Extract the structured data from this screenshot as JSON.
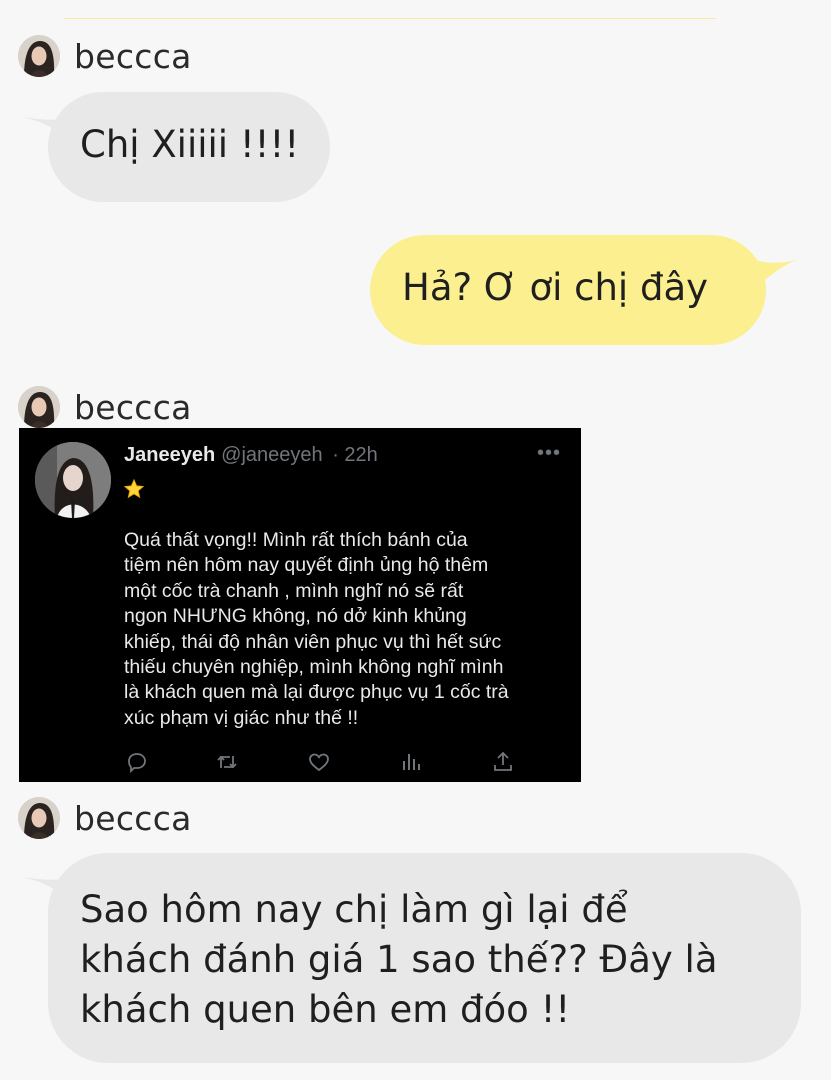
{
  "chat": {
    "messages": [
      {
        "sender": "beccca",
        "text": "Chị Xiiiii !!!!"
      },
      {
        "sender": "me",
        "text": "Hả? Ơ ơi chị đây"
      },
      {
        "sender": "beccca",
        "tweet": true
      },
      {
        "sender": "beccca",
        "lines": [
          "Sao hôm nay chị làm gì lại để",
          "khách đánh giá 1 sao thế?? Đây là",
          "khách quen bên em đóo !!"
        ]
      }
    ]
  },
  "tweet": {
    "name": "Janeeyeh",
    "handle": "@janeeyeh",
    "time": "· 22h",
    "emoji": "star",
    "text": "Quá thất vọng!! Mình rất thích bánh của\ntiệm nên hôm nay quyết định ủng hộ thêm\nmột cốc trà chanh , mình nghĩ nó sẽ rất\nngon NHƯNG không, nó dở kinh khủng\nkhiếp, thái độ nhân viên phục vụ thì hết sức\nthiếu chuyên nghiệp, mình không nghĩ mình\nlà khách quen mà lại được phục vụ 1 cốc trà\nxúc phạm vị giác như thế !!",
    "more": "•••",
    "actions": [
      "reply-icon",
      "retweet-icon",
      "like-icon",
      "views-icon",
      "share-icon"
    ]
  },
  "colors": {
    "incoming_bubble": "#e8e8e8",
    "outgoing_bubble": "#fbef90",
    "background": "#f7f7f7",
    "tweet_bg": "#000000"
  }
}
